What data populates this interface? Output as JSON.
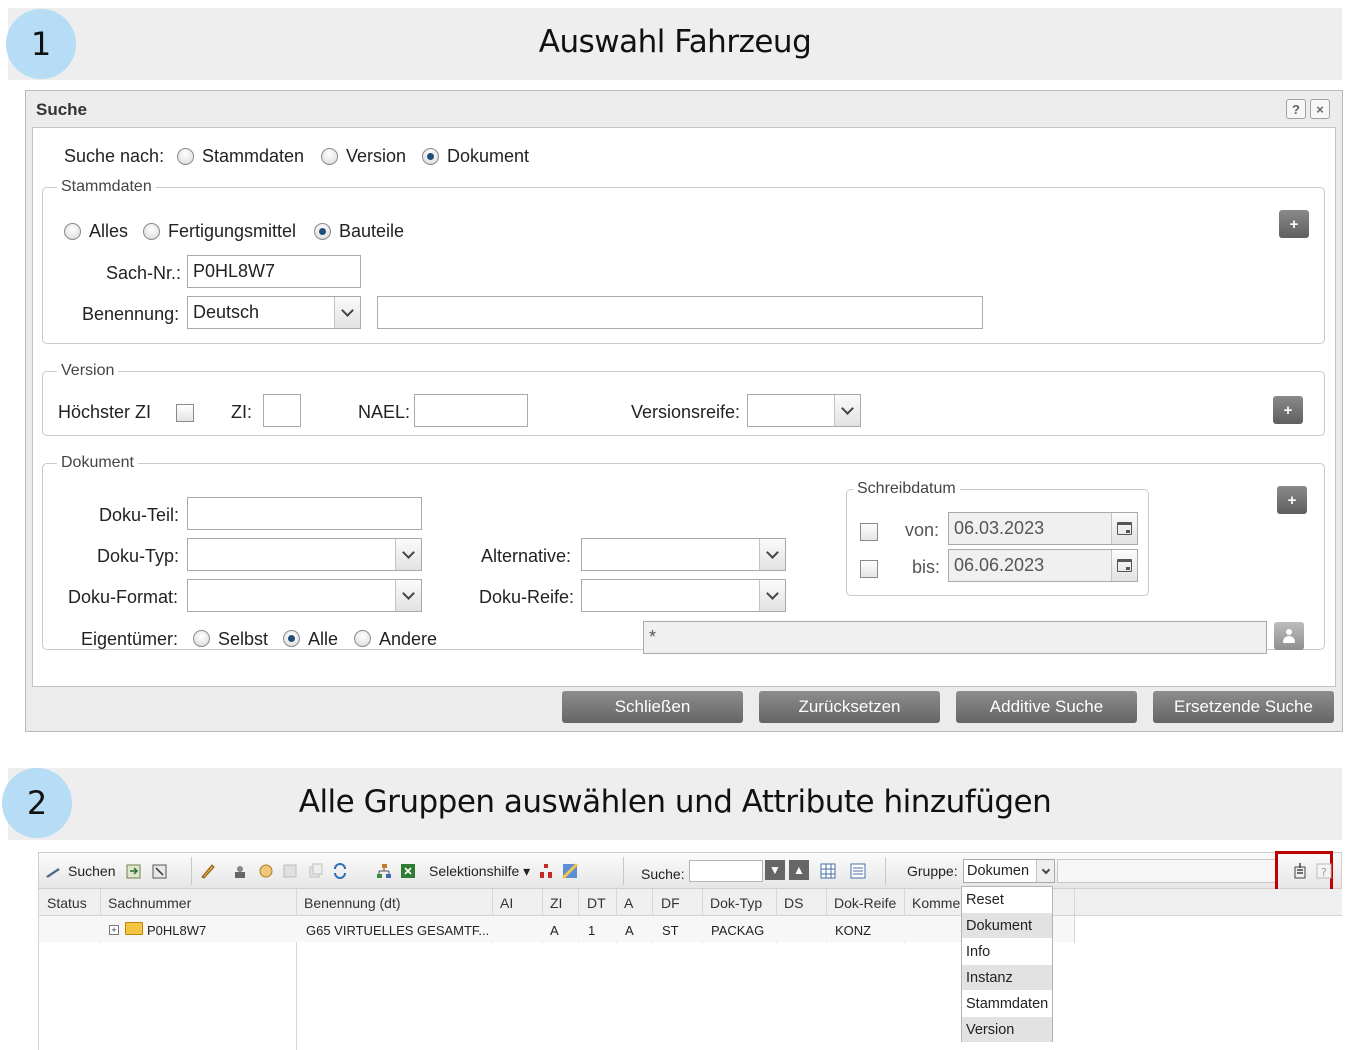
{
  "steps": [
    {
      "number": "1",
      "title": "Auswahl Fahrzeug"
    },
    {
      "number": "2",
      "title": "Alle Gruppen auswählen und Attribute hinzufügen"
    }
  ],
  "dialog": {
    "title": "Suche",
    "help_label": "?",
    "close_label": "×",
    "search_by": {
      "label": "Suche nach:",
      "options": [
        "Stammdaten",
        "Version",
        "Dokument"
      ],
      "selected": "Dokument"
    },
    "stammdaten": {
      "legend": "Stammdaten",
      "options": [
        "Alles",
        "Fertigungsmittel",
        "Bauteile"
      ],
      "selected": "Bauteile",
      "sach_nr_label": "Sach-Nr.:",
      "sach_nr_value": "P0HL8W7",
      "benennung_label": "Benennung:",
      "benennung_lang": "Deutsch",
      "benennung_text": "",
      "plus": "+"
    },
    "version": {
      "legend": "Version",
      "hoechster_zi_label": "Höchster ZI",
      "zi_label": "ZI:",
      "zi_value": "",
      "nael_label": "NAEL:",
      "nael_value": "",
      "versionsreife_label": "Versionsreife:",
      "versionsreife_value": "",
      "plus": "+"
    },
    "dokument": {
      "legend": "Dokument",
      "doku_teil_label": "Doku-Teil:",
      "doku_typ_label": "Doku-Typ:",
      "doku_format_label": "Doku-Format:",
      "alternative_label": "Alternative:",
      "doku_reife_label": "Doku-Reife:",
      "eigentuemer_label": "Eigentümer:",
      "eigentuemer_options": [
        "Selbst",
        "Alle",
        "Andere"
      ],
      "eigentuemer_selected": "Alle",
      "owner_value": "*",
      "plus": "+",
      "schreibdatum": {
        "legend": "Schreibdatum",
        "von_label": "von:",
        "von_value": "06.03.2023",
        "bis_label": "bis:",
        "bis_value": "06.06.2023"
      }
    },
    "buttons": [
      "Schließen",
      "Zurücksetzen",
      "Additive Suche",
      "Ersetzende Suche"
    ]
  },
  "screen2": {
    "toolbar": {
      "suchen_label": "Suchen",
      "selektionshilfe_label": "Selektionshilfe ▾",
      "suche_label": "Suche:",
      "suche_value": "",
      "gruppe_label": "Gruppe:",
      "gruppe_value": "Dokumen"
    },
    "columns": [
      "Status",
      "Sachnummer",
      "Benennung (dt)",
      "AI",
      "ZI",
      "DT",
      "A",
      "DF",
      "Dok-Typ",
      "DS",
      "Dok-Reife",
      "Kommer"
    ],
    "rows": [
      {
        "status": "",
        "sachnummer": "P0HL8W7",
        "benennung": "G65 VIRTUELLES GESAMTF...",
        "ai": "",
        "zi": "A",
        "dt": "1",
        "a": "A",
        "df": "ST",
        "dok_typ": "PACKAG",
        "ds": "",
        "dok_reife": "KONZ"
      }
    ],
    "group_dropdown": [
      "Reset",
      "Dokument",
      "Info",
      "Instanz",
      "Stammdaten",
      "Version"
    ],
    "highlight_color": "#c00000"
  },
  "colors": {
    "step_circle": "#b7dcf5",
    "step_bar": "#eeeeee",
    "radio_dot": "#1f4d7a"
  }
}
